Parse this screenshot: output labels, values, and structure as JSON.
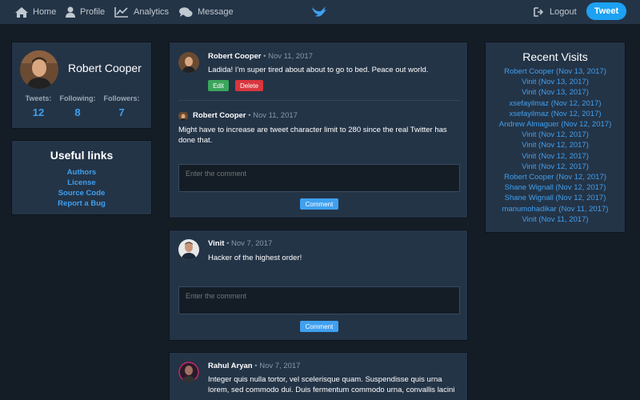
{
  "nav": {
    "home": "Home",
    "profile": "Profile",
    "analytics": "Analytics",
    "message": "Message",
    "logout": "Logout",
    "tweet": "Tweet"
  },
  "profile": {
    "name": "Robert Cooper",
    "tweets_label": "Tweets:",
    "tweets": "12",
    "following_label": "Following:",
    "following": "8",
    "followers_label": "Followers:",
    "followers": "7"
  },
  "links": {
    "title": "Useful links",
    "items": [
      "Authors",
      "License",
      "Source Code",
      "Report a Bug"
    ]
  },
  "recent": {
    "title": "Recent Visits",
    "items": [
      "Robert Cooper (Nov 13, 2017)",
      "Vinit (Nov 13, 2017)",
      "Vinit (Nov 13, 2017)",
      "xsefayilmaz (Nov 12, 2017)",
      "xsefayilmaz (Nov 12, 2017)",
      "Andrew Almaguer (Nov 12, 2017)",
      "Vinit (Nov 12, 2017)",
      "Vinit (Nov 12, 2017)",
      "Vinit (Nov 12, 2017)",
      "Vinit (Nov 12, 2017)",
      "Robert Cooper (Nov 12, 2017)",
      "Shane Wignall (Nov 12, 2017)",
      "Shane Wignall (Nov 12, 2017)",
      "manumohadikar (Nov 11, 2017)",
      "Vinit (Nov 11, 2017)"
    ]
  },
  "tweets": [
    {
      "author": "Robert Cooper",
      "date": "• Nov 11, 2017",
      "text": "Ladida! I'm super tired about about to go to bed. Peace out world.",
      "edit": "Edit",
      "delete": "Delete"
    },
    {
      "author": "Robert Cooper",
      "date": "• Nov 11, 2017",
      "text": "Might have to increase are tweet character limit to 280 since the real Twitter has done that."
    },
    {
      "author": "Vinit",
      "date": "• Nov 7, 2017",
      "text": "Hacker of the highest order!"
    },
    {
      "author": "Rahul Aryan",
      "date": "• Nov 7, 2017",
      "text": "Integer quis nulla tortor, vel scelerisque quam. Suspendisse quis urna lorem, sed commodo dui. Duis fermentum commodo urna, convallis lacini"
    }
  ],
  "comment": {
    "placeholder": "Enter the comment",
    "button": "Comment"
  },
  "colors": {
    "background": "#141d26",
    "panel": "#243447",
    "accent": "#1da1f2",
    "link": "#3fa0f0"
  }
}
